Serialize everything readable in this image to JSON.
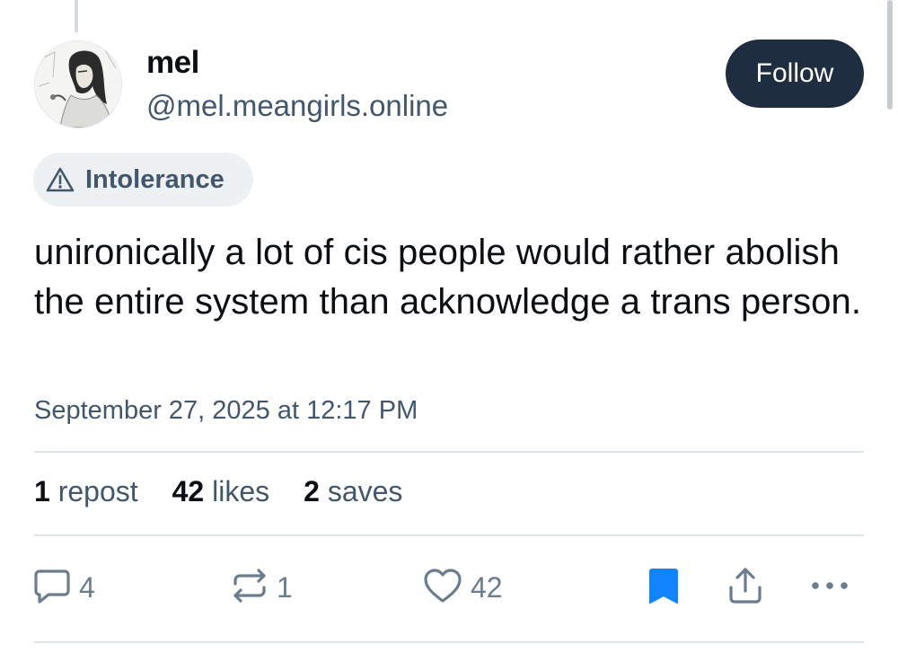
{
  "author": {
    "display_name": "mel",
    "handle": "@mel.meangirls.online",
    "avatar": "illustrated-portrait-avatar"
  },
  "follow_button": {
    "label": "Follow"
  },
  "content_label": {
    "icon": "warning-triangle-icon",
    "text": "Intolerance"
  },
  "post": {
    "text": "unironically a lot of cis people would rather abolish the entire system than acknowledge a trans person.",
    "timestamp": "September 27, 2025 at 12:17 PM"
  },
  "stats": [
    {
      "count": "1",
      "label": "repost"
    },
    {
      "count": "42",
      "label": "likes"
    },
    {
      "count": "2",
      "label": "saves"
    }
  ],
  "actions": {
    "reply": {
      "icon": "reply-bubble-icon",
      "count": "4"
    },
    "repost": {
      "icon": "repost-icon",
      "count": "1"
    },
    "like": {
      "icon": "heart-icon",
      "count": "42"
    },
    "save": {
      "icon": "bookmark-icon",
      "state": "saved"
    },
    "share": {
      "icon": "share-icon"
    },
    "more": {
      "icon": "more-dots-icon"
    }
  },
  "colors": {
    "text_primary": "#0b0f14",
    "text_secondary": "#42576c",
    "follow_bg": "#1e2d3f",
    "bookmark_active": "#1083fe",
    "action_gray": "#6a7d8f"
  }
}
